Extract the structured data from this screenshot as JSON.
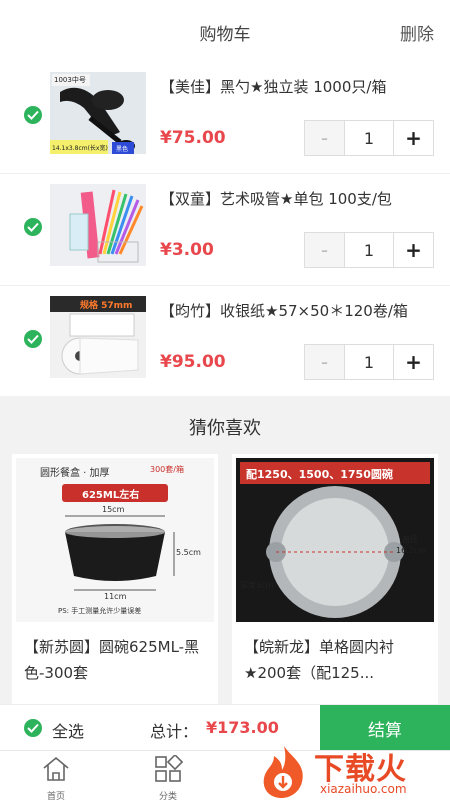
{
  "header": {
    "title": "购物车",
    "delete_label": "删除"
  },
  "cart": {
    "items": [
      {
        "title": "【美佳】黑勺★独立装 1000只/箱",
        "price": "¥75.00",
        "qty": "1",
        "minus": "-",
        "plus": "+",
        "thumb_text_1": "1003中号",
        "thumb_text_2": "14.1x3.8cm(长x宽)",
        "thumb_text_3": "黑色"
      },
      {
        "title": "【双童】艺术吸管★单包 100支/包",
        "price": "¥3.00",
        "qty": "1",
        "minus": "-",
        "plus": "+"
      },
      {
        "title": "【昀竹】收银纸★57×50＊120卷/箱",
        "price": "¥95.00",
        "qty": "1",
        "minus": "-",
        "plus": "+",
        "thumb_text_1": "规格 57mm"
      }
    ]
  },
  "recommend": {
    "title": "猜你喜欢",
    "cards": [
      {
        "name": "【新苏圆】圆碗625ML-黑色-300套",
        "img_text_1": "圆形餐盒 · 加厚",
        "img_text_2": "300套/箱",
        "img_text_3": "625ML左右",
        "img_text_4": "15cm",
        "img_text_5": "5.5cm",
        "img_text_6": "11cm",
        "img_text_7": "PS: 手工测量允许少量误差"
      },
      {
        "name": "【皖新龙】单格圆内衬★200套（配125...",
        "img_text_1": "配1250、1500、1750圆碗",
        "img_text_2": "直径",
        "img_text_3": "16.2cm",
        "img_text_4": "深度3cm"
      }
    ]
  },
  "footer": {
    "select_all": "全选",
    "total_label": "总计：",
    "total_value": "¥173.00",
    "checkout": "结算"
  },
  "tabbar": {
    "home": "首页",
    "category": "分类"
  },
  "watermark": {
    "text": "下载火",
    "sub": "xiazaihuo.com"
  },
  "colors": {
    "accent_green": "#2db35b",
    "price_red": "#e8474c"
  }
}
